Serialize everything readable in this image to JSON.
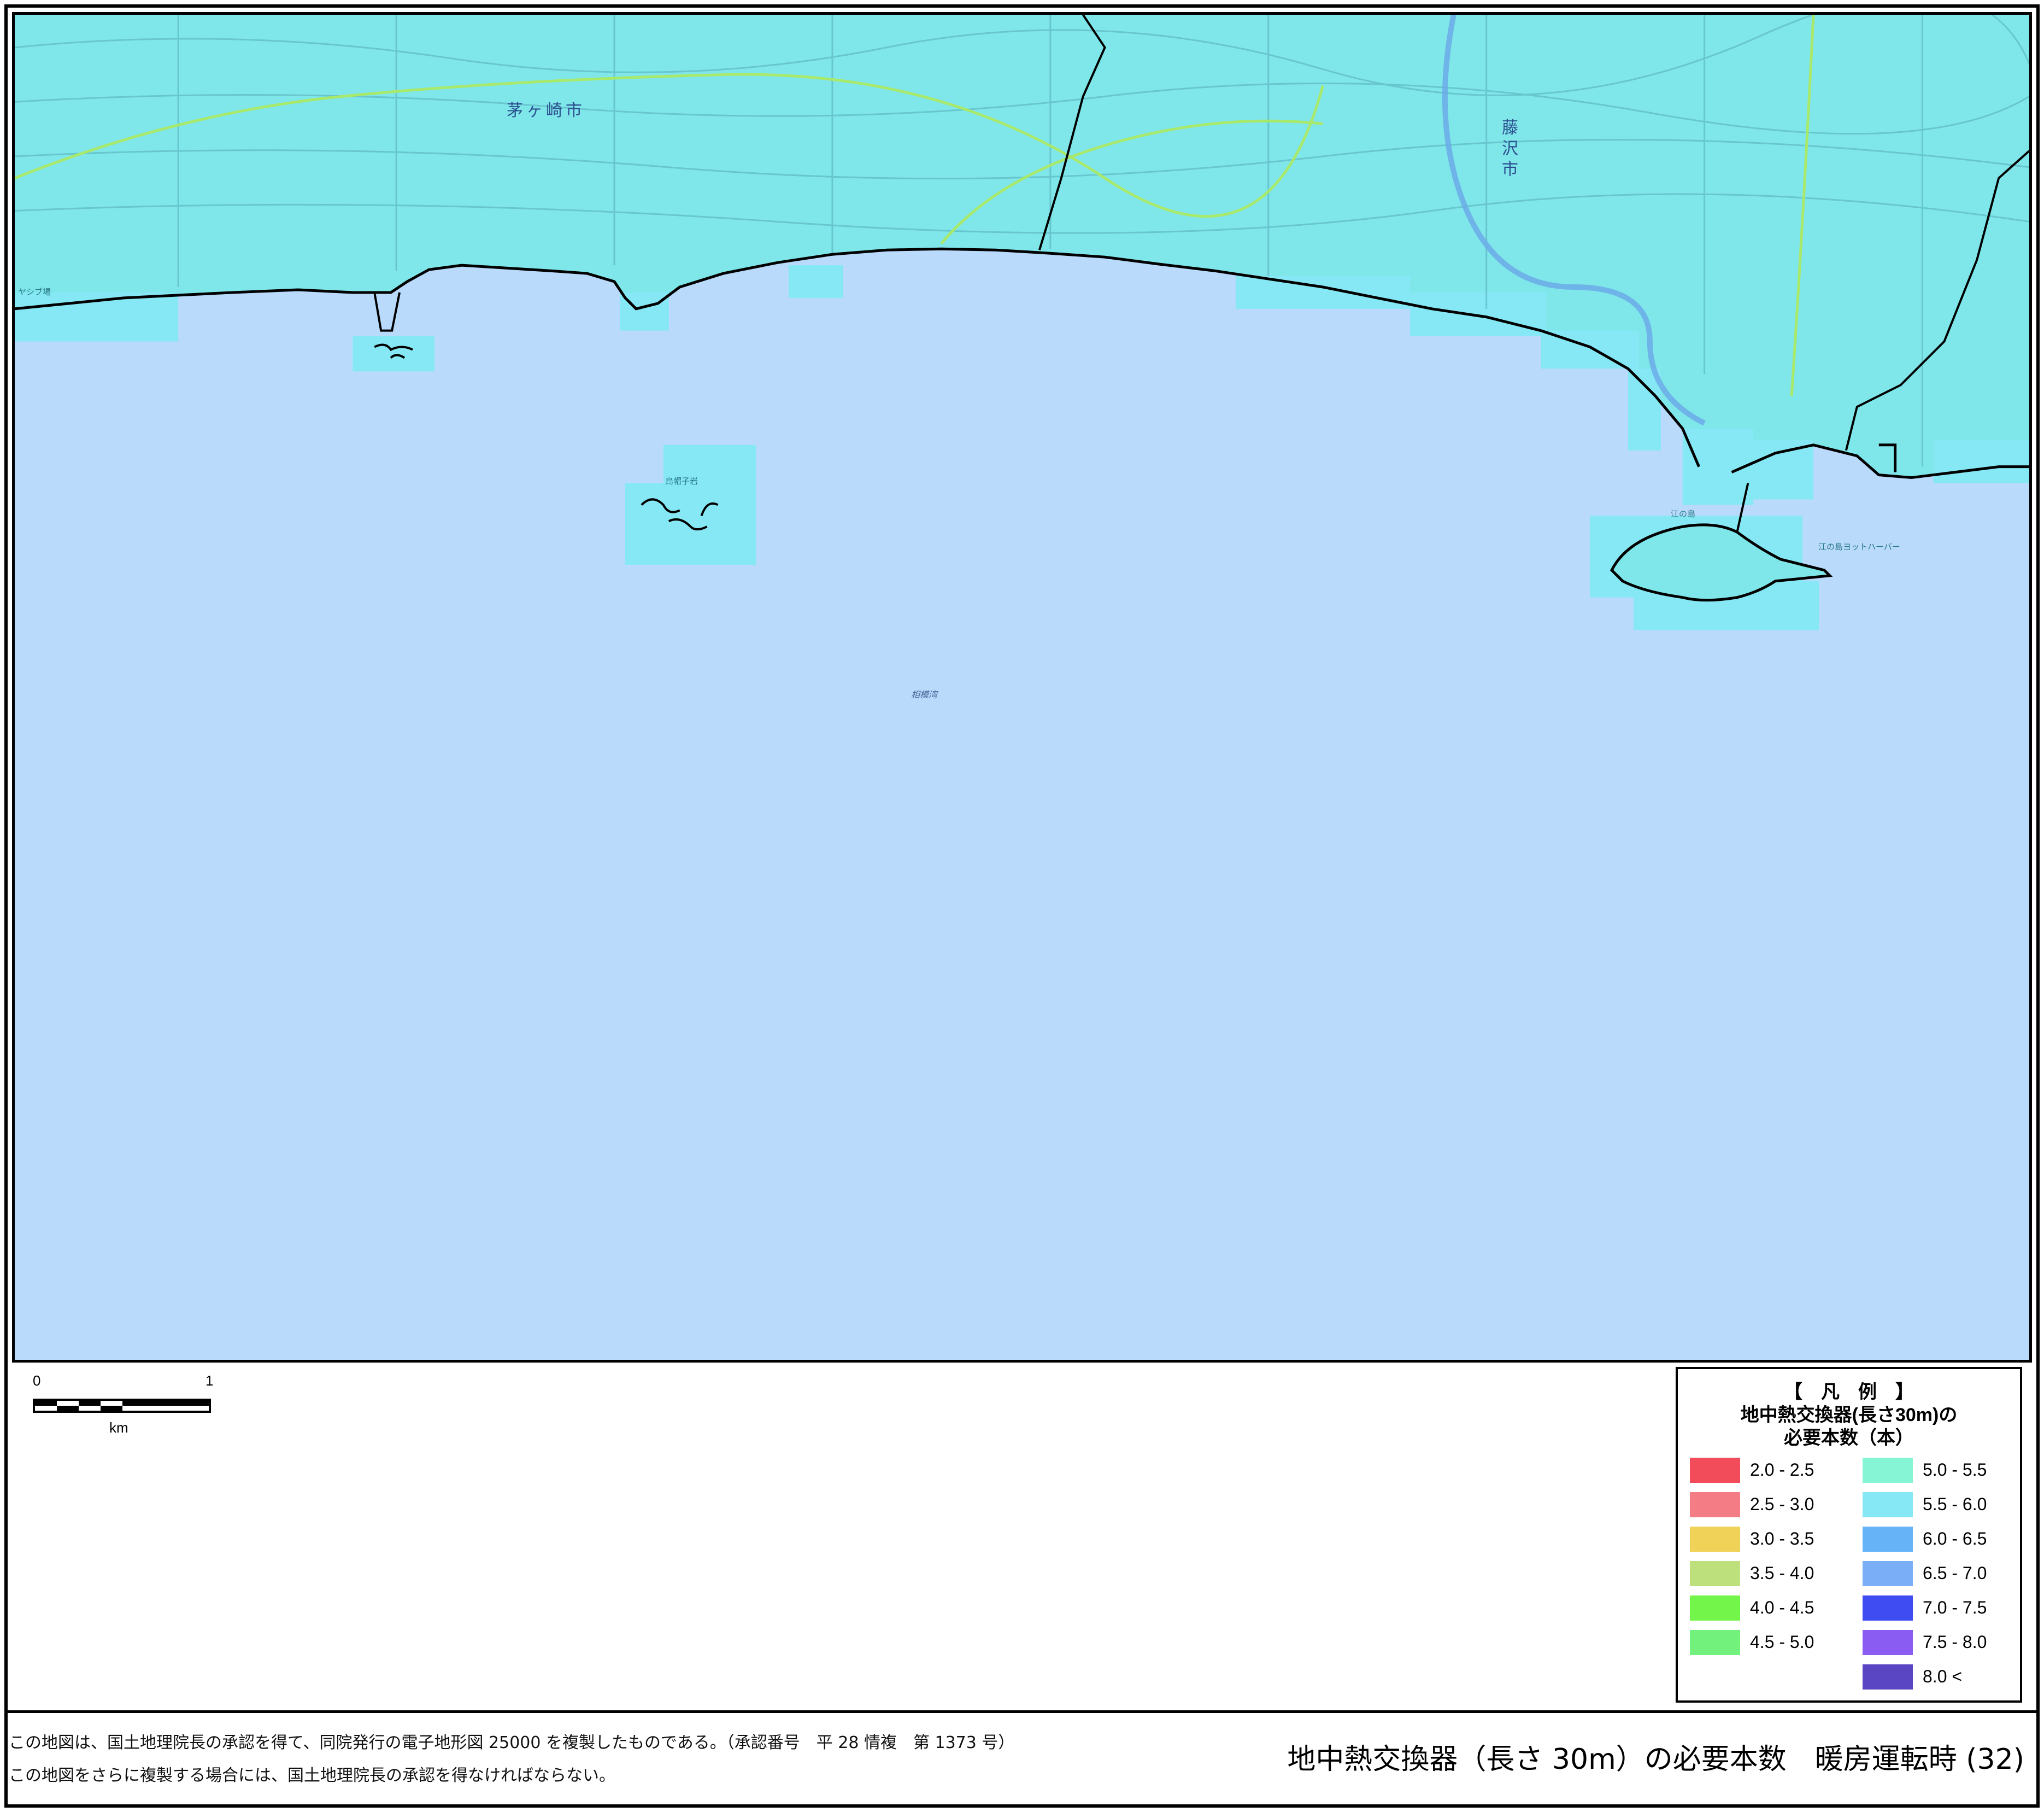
{
  "map": {
    "place_labels": {
      "chigasaki": "茅ヶ崎市",
      "fujisawa": "藤沢市"
    },
    "sea_label": "相模湾",
    "poi_labels": {
      "eboshi": "烏帽子岩",
      "enoshima": "江の島",
      "enoshima_yacht": "江の島ヨットハーバー",
      "chigasaki_camp": "ヤシブ場"
    },
    "colors": {
      "sea": "#b9dafb",
      "land_tint": "#7fe6ea",
      "boundary": "#000000"
    }
  },
  "scale_bar": {
    "start_label": "0",
    "end_label": "1",
    "unit": "km"
  },
  "legend": {
    "heading": "【　凡　例　】",
    "title_line1": "地中熱交換器(長さ30m)の",
    "title_line2": "必要本数（本）",
    "items_left": [
      {
        "label": "2.0 ‐ 2.5",
        "color": "#f24c5a"
      },
      {
        "label": "2.5 ‐ 3.0",
        "color": "#f47c84"
      },
      {
        "label": "3.0 ‐ 3.5",
        "color": "#efd257"
      },
      {
        "label": "3.5 ‐ 4.0",
        "color": "#bde07c"
      },
      {
        "label": "4.0 ‐ 4.5",
        "color": "#74f54a"
      },
      {
        "label": "4.5 ‐ 5.0",
        "color": "#72f27c"
      }
    ],
    "items_right": [
      {
        "label": "5.0 ‐ 5.5",
        "color": "#86f5d6"
      },
      {
        "label": "5.5 ‐ 6.0",
        "color": "#86e8f5"
      },
      {
        "label": "6.0 ‐ 6.5",
        "color": "#67b3f7"
      },
      {
        "label": "6.5 ‐ 7.0",
        "color": "#7aaef7"
      },
      {
        "label": "7.0 ‐ 7.5",
        "color": "#3f4cf2"
      },
      {
        "label": "7.5 ‐ 8.0",
        "color": "#8a5cf2"
      },
      {
        "label": "8.0 <",
        "color": "#5a46c2"
      }
    ]
  },
  "footer": {
    "note1": "この地図は、国土地理院長の承認を得て、同院発行の電子地形図 25000 を複製したものである。（承認番号　平 28 情複　第 1373 号）",
    "note2": "この地図をさらに複製する場合には、国土地理院長の承認を得なければならない。",
    "title": "地中熱交換器（長さ 30m）の必要本数　暖房運転時 (32)"
  }
}
